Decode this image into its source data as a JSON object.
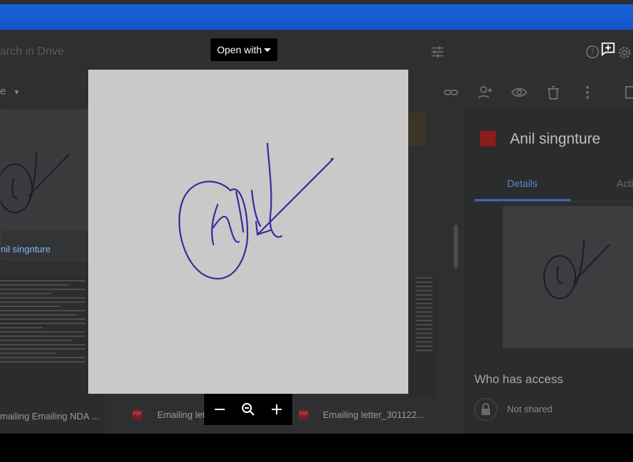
{
  "drive": {
    "search_placeholder": "arch in Drive",
    "folder_name": "e",
    "grid": {
      "cards": [
        {
          "name": "nil singnture"
        },
        {
          "label": "mailing Emailing NDA ..."
        },
        {
          "label": "Emailing letter_30112..."
        },
        {
          "label": "Emailing letter_301122..."
        }
      ]
    },
    "details_panel": {
      "file_name": "Anil singnture",
      "tabs": [
        "Details",
        "Acti"
      ],
      "active_tab": "Details",
      "access_heading": "Who has access",
      "access_status": "Not shared"
    }
  },
  "viewer": {
    "open_with_label": "Open with",
    "zoom_buttons": [
      "zoom-out",
      "zoom-reset",
      "zoom-in"
    ]
  },
  "colors": {
    "accent_blue": "#1a5fd6",
    "link_blue": "#8ab4f8",
    "tab_blue": "#3f66b3",
    "image_red": "#8b1d1d",
    "signature_ink": "#3a2a9a"
  }
}
